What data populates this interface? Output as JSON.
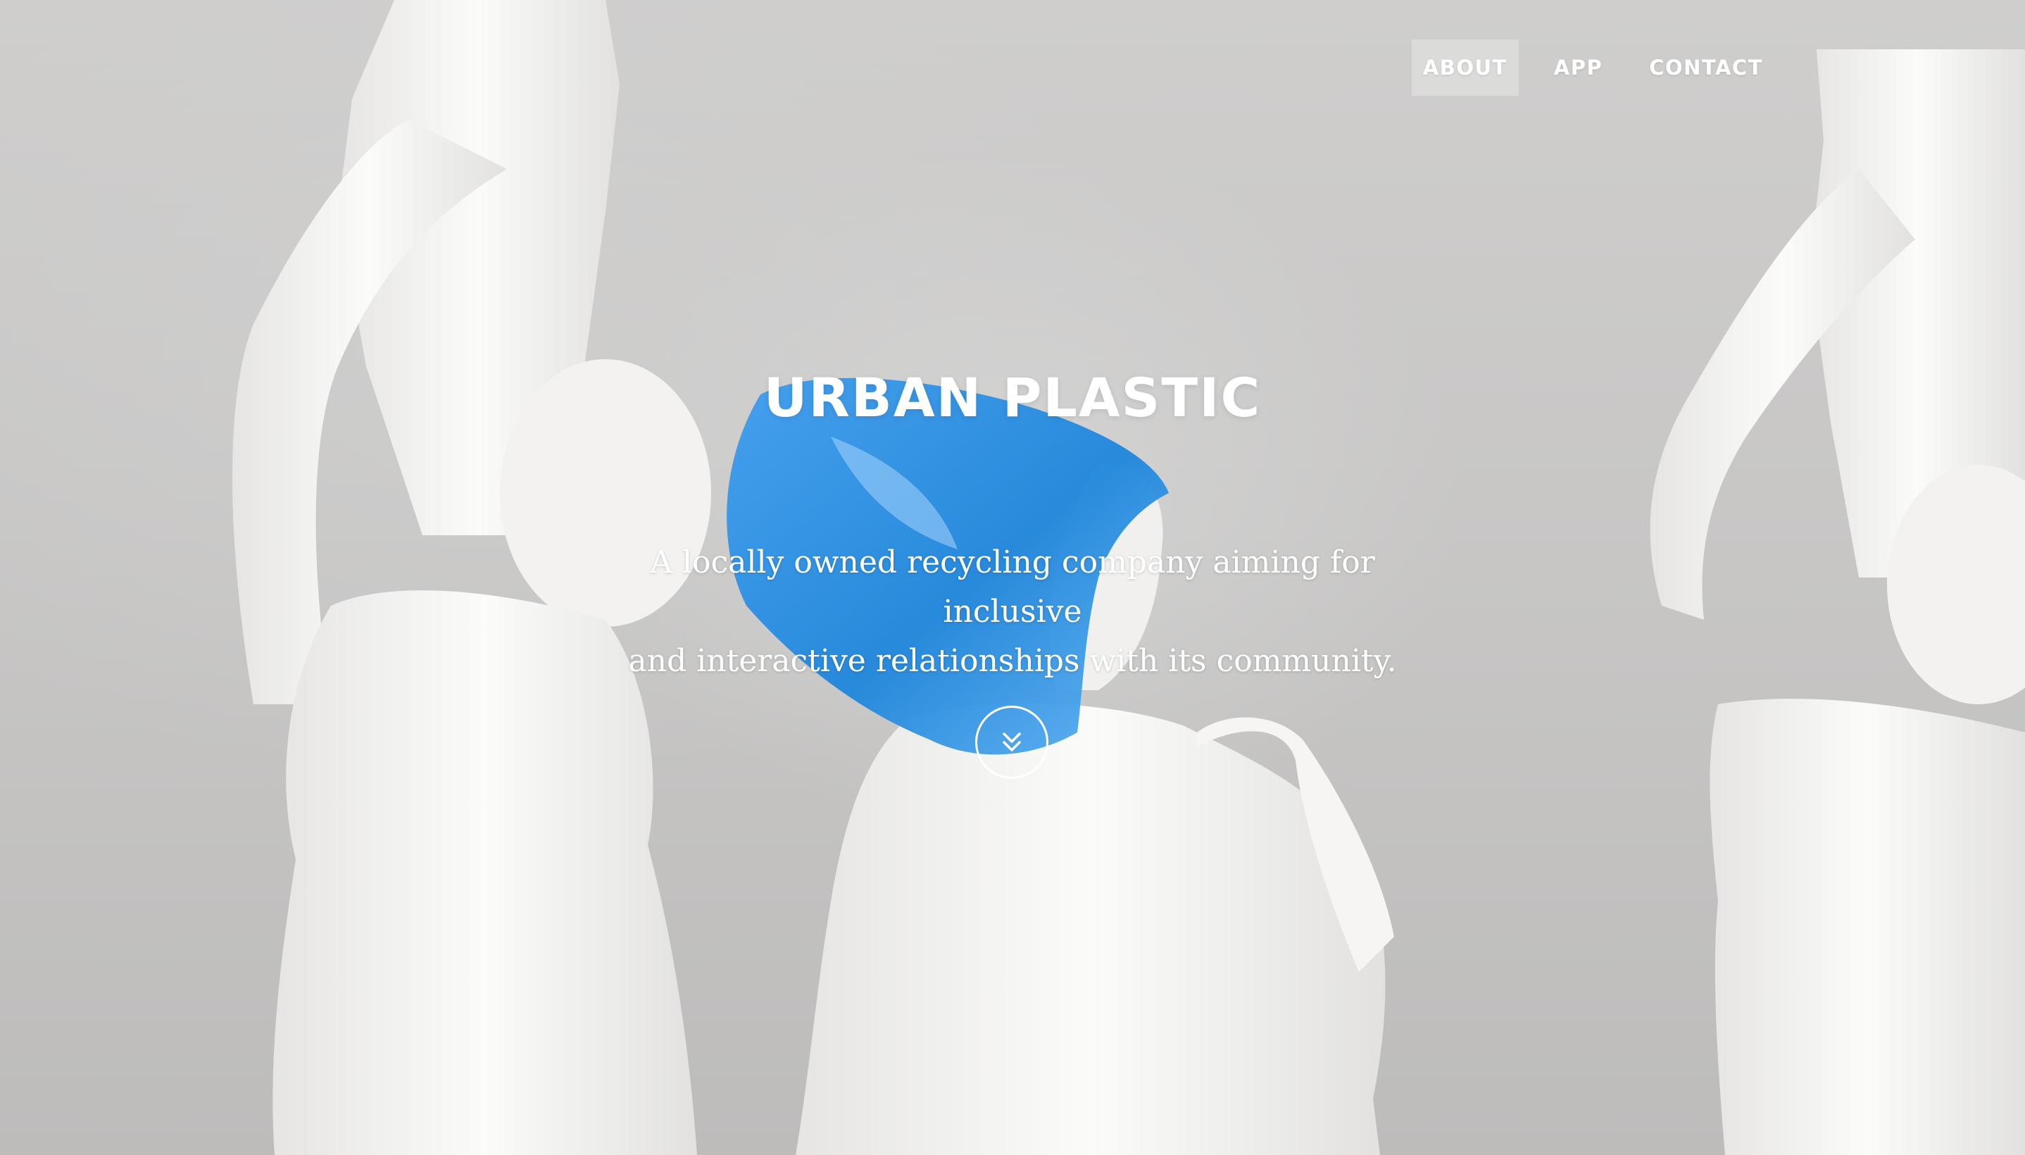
{
  "nav": {
    "items": [
      {
        "label": "ABOUT",
        "active": true
      },
      {
        "label": "APP",
        "active": false
      },
      {
        "label": "CONTACT",
        "active": false
      }
    ]
  },
  "hero": {
    "title": "URBAN PLASTIC",
    "subtitle_line1": "A locally owned recycling company aiming for inclusive",
    "subtitle_line2": "and interactive relationships with its community.",
    "scroll_icon": "double-chevron-down-icon"
  },
  "colors": {
    "text": "#ffffff",
    "bag_blue": "#2e8fe0",
    "statue_white": "#f4f3f2",
    "wall_grey": "#c9c8c8"
  }
}
